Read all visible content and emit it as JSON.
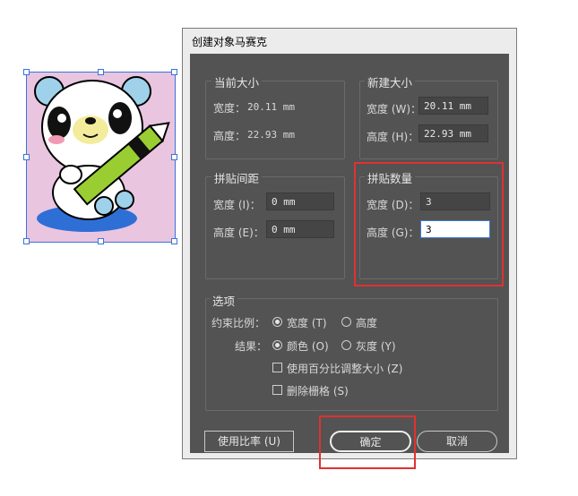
{
  "dialog": {
    "title": "创建对象马赛克",
    "current_size": {
      "legend": "当前大小",
      "width_label": "宽度：",
      "width_value": "20.11 mm",
      "height_label": "高度：",
      "height_value": "22.93 mm"
    },
    "new_size": {
      "legend": "新建大小",
      "width_label": "宽度 (W)：",
      "width_value": "20.11 mm",
      "height_label": "高度 (H)：",
      "height_value": "22.93 mm"
    },
    "tile_spacing": {
      "legend": "拼贴间距",
      "width_label": "宽度 (I)：",
      "width_value": "0 mm",
      "height_label": "高度 (E)：",
      "height_value": "0 mm"
    },
    "tile_count": {
      "legend": "拼贴数量",
      "width_label": "宽度 (D)：",
      "width_value": "3",
      "height_label": "高度 (G)：",
      "height_value": "3"
    },
    "options": {
      "legend": "选项",
      "constrain_label": "约束比例：",
      "constrain_width": "宽度 (T)",
      "constrain_height": "高度",
      "result_label": "结果：",
      "result_color": "颜色 (O)",
      "result_gray": "灰度 (Y)",
      "resize_percent": "使用百分比调整大小 (Z)",
      "delete_raster": "删除栅格 (S)"
    },
    "use_ratio_button": "使用比率 (U)",
    "ok_button": "确定",
    "cancel_button": "取消"
  },
  "colors": {
    "highlight": "#e03131",
    "dialog_bg": "#535353",
    "selection": "#3b73d9",
    "artwork_bg": "#e9c5e0"
  },
  "icons": [
    "bear-illustration",
    "radio-icon",
    "checkbox-icon"
  ]
}
